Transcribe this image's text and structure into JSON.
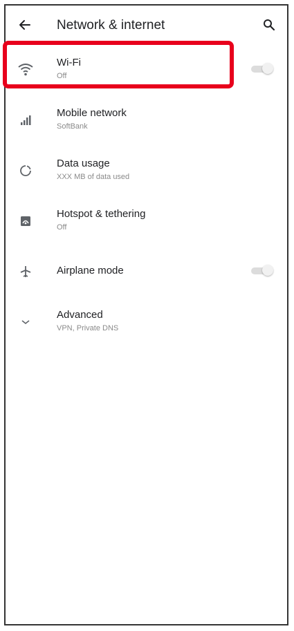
{
  "header": {
    "title": "Network & internet",
    "back_icon": "arrow-back-icon",
    "search_icon": "search-icon"
  },
  "items": [
    {
      "icon": "wifi-icon",
      "label": "Wi-Fi",
      "sub": "Off",
      "toggle": "off"
    },
    {
      "icon": "signal-icon",
      "label": "Mobile network",
      "sub": "SoftBank"
    },
    {
      "icon": "data-usage-icon",
      "label": "Data usage",
      "sub": "XXX MB of data used"
    },
    {
      "icon": "hotspot-icon",
      "label": "Hotspot & tethering",
      "sub": "Off"
    },
    {
      "icon": "airplane-icon",
      "label": "Airplane mode",
      "toggle": "off"
    },
    {
      "icon": "chevron-down-icon",
      "label": "Advanced",
      "sub": "VPN, Private DNS"
    }
  ],
  "colors": {
    "highlight": "#e8001c",
    "text_primary": "#202124",
    "text_secondary": "#8a8a8a",
    "icon": "#5f6368"
  }
}
